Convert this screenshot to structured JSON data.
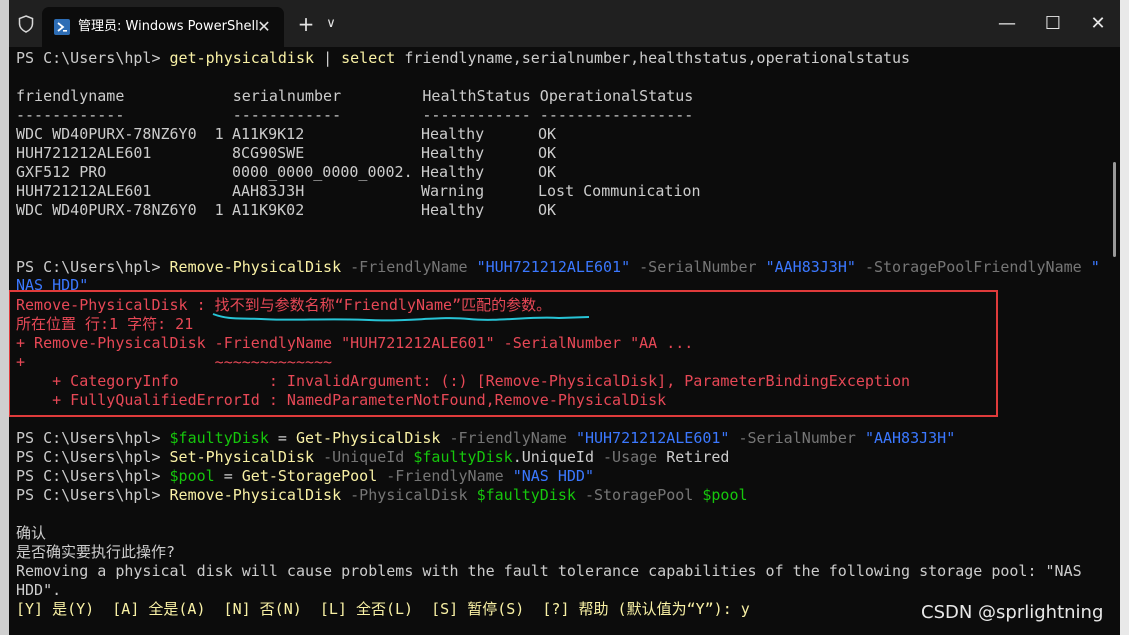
{
  "window": {
    "tab_title": "管理员: Windows PowerShell",
    "new_tab_symbol": "+",
    "dropdown_symbol": "∨",
    "minimize_symbol": "—",
    "maximize_symbol": "☐",
    "close_symbol": "✕"
  },
  "terminal": {
    "prompt": "PS C:\\Users\\hpl>",
    "cmd1": {
      "cmdlet": "get-physicaldisk",
      "pipe": "|",
      "select": "select",
      "args": "friendlyname,serialnumber,healthstatus,operationalstatus"
    },
    "table": {
      "header": "friendlyname            serialnumber         HealthStatus OperationalStatus",
      "divider": "------------            ------------         ------------ -----------------",
      "rows": [
        {
          "name": "WDC WD40PURX-78NZ6Y0  1",
          "serial": "A11K9K12",
          "health": "Healthy",
          "status": "OK"
        },
        {
          "name": "HUH721212ALE601",
          "serial": "8CG90SWE",
          "health": "Healthy",
          "status": "OK"
        },
        {
          "name": "GXF512 PRO",
          "serial": "0000_0000_0000_0002.",
          "health": "Healthy",
          "status": "OK"
        },
        {
          "name": "HUH721212ALE601",
          "serial": "AAH83J3H",
          "health": "Warning",
          "status": "Lost Communication"
        },
        {
          "name": "WDC WD40PURX-78NZ6Y0  1",
          "serial": "A11K9K02",
          "health": "Healthy",
          "status": "OK"
        }
      ]
    },
    "cmd2": {
      "cmdlet": "Remove-PhysicalDisk",
      "p1": "-FriendlyName",
      "v1": "\"HUH721212ALE601\"",
      "p2": "-SerialNumber",
      "v2": "\"AAH83J3H\"",
      "p3": "-StoragePoolFriendlyName",
      "v3a": "\"",
      "v3b": "NAS HDD\""
    },
    "error": {
      "line1": "Remove-PhysicalDisk : 找不到与参数名称“FriendlyName”匹配的参数。",
      "line2": "所在位置 行:1 字符: 21",
      "line3": "+ Remove-PhysicalDisk -FriendlyName \"HUH721212ALE601\" -SerialNumber \"AA ...",
      "line4": "+                     ~~~~~~~~~~~~~",
      "line5": "    + CategoryInfo          : InvalidArgument: (:) [Remove-PhysicalDisk], ParameterBindingException",
      "line6": "    + FullyQualifiedErrorId : NamedParameterNotFound,Remove-PhysicalDisk"
    },
    "cmd3": {
      "var": "$faultyDisk",
      "eq": "=",
      "cmdlet": "Get-PhysicalDisk",
      "p1": "-FriendlyName",
      "v1": "\"HUH721212ALE601\"",
      "p2": "-SerialNumber",
      "v2": "\"AAH83J3H\""
    },
    "cmd4": {
      "cmdlet": "Set-PhysicalDisk",
      "p1": "-UniqueId",
      "var": "$faultyDisk",
      "prop": ".UniqueId",
      "p2": "-Usage",
      "v2": "Retired"
    },
    "cmd5": {
      "var": "$pool",
      "eq": "=",
      "cmdlet": "Get-StoragePool",
      "p1": "-FriendlyName",
      "v1": "\"NAS HDD\""
    },
    "cmd6": {
      "cmdlet": "Remove-PhysicalDisk",
      "p1": "-PhysicalDisk",
      "v1": "$faultyDisk",
      "p2": "-StoragePool",
      "v2": "$pool"
    },
    "confirm": {
      "title": "确认",
      "question": "是否确实要执行此操作?",
      "message1": "Removing a physical disk will cause problems with the fault tolerance capabilities of the following storage pool: \"NAS",
      "message2": "HDD\".",
      "options": "[Y] 是(Y)  [A] 全是(A)  [N] 否(N)  [L] 全否(L)  [S] 暂停(S)  [?] 帮助 (默认值为“Y”): y"
    }
  },
  "watermark": "CSDN @sprlightning"
}
